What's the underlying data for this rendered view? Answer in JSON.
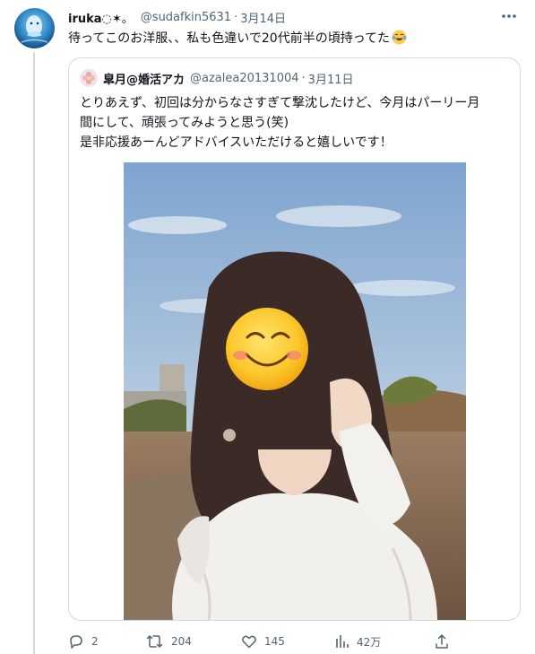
{
  "author": {
    "display_name": "iruka",
    "display_suffix": "◌✶。",
    "handle": "@sudafkin5631",
    "separator": "·",
    "date": "3月14日",
    "avatar_icon": "dolphin-avatar-icon"
  },
  "tweet": {
    "text": "待ってこのお洋服、、私も色違いで20代前半の頃持ってた",
    "emoji_icon": "laughing-tears-emoji-icon"
  },
  "quoted_tweet": {
    "display_name": "皐月@婚活アカ",
    "handle": "@azalea20131004",
    "separator": "·",
    "date": "3月11日",
    "lines": [
      "とりあえず、初回は分からなさすぎて撃沈したけど、今月はパーリー月",
      "間にして、頑張ってみようと思う(笑)",
      "是非応援あーんどアドバイスいただけると嬉しいです！"
    ],
    "photo_icon": "selfie-photo-with-smiley-sticker"
  },
  "actions": {
    "reply_count": "2",
    "retweet_count": "204",
    "like_count": "145",
    "views_count": "42万"
  },
  "colors": {
    "text_primary": "#0f1419",
    "text_secondary": "#536471",
    "border": "#cfd9de"
  }
}
